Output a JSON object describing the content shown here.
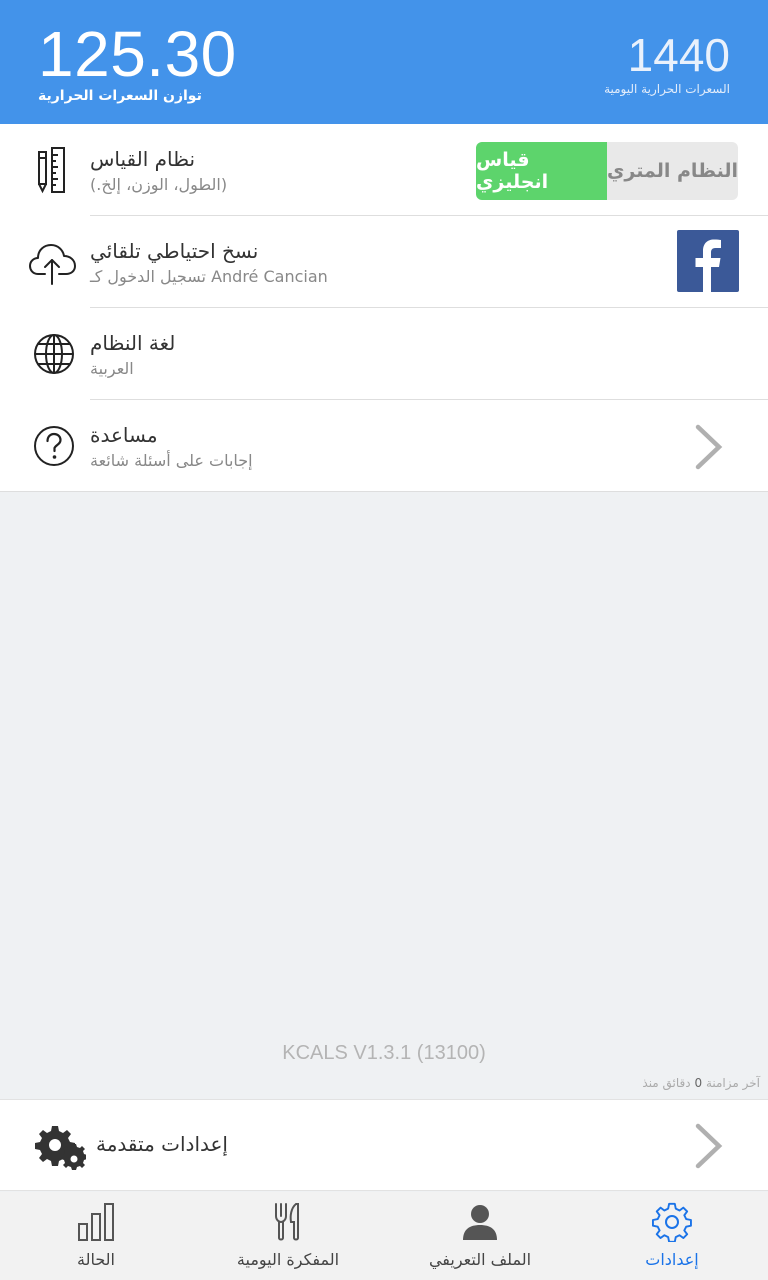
{
  "header": {
    "balance_value": "125.30",
    "balance_label": "توازن السعرات الحرارية",
    "daily_value": "1440",
    "daily_label": "السعرات الحرارية اليومية"
  },
  "settings": {
    "units": {
      "title": "نظام القياس",
      "desc": "(.الطول، الوزن، إلخ)",
      "option_imperial": "قياس انجليزي",
      "option_metric": "النظام المتري",
      "selected": "imperial"
    },
    "backup": {
      "title": "نسخ احتياطي تلقائي",
      "desc": "تسجيل الدخول كـ André Cancian"
    },
    "language": {
      "title": "لغة النظام",
      "desc": "العربية"
    },
    "help": {
      "title": "مساعدة",
      "desc": "إجابات على أسئلة شائعة"
    }
  },
  "footer": {
    "version": "KCALS V1.3.1 (13100)",
    "sync_prefix": "آخر مزامنة",
    "sync_count": "0",
    "sync_suffix": "دقائق منذ"
  },
  "advanced": {
    "label": "إعدادات متقدمة"
  },
  "tabs": [
    {
      "label": "الحالة",
      "icon": "bar-chart-icon"
    },
    {
      "label": "المفكرة اليومية",
      "icon": "fork-knife-icon"
    },
    {
      "label": "الملف التعريفي",
      "icon": "person-icon"
    },
    {
      "label": "إعدادات",
      "icon": "gear-icon",
      "active": true
    }
  ],
  "colors": {
    "header_bg": "#4393ea",
    "toggle_active": "#5dd46c",
    "facebook": "#3b5998",
    "active_tab": "#1a73e8"
  }
}
